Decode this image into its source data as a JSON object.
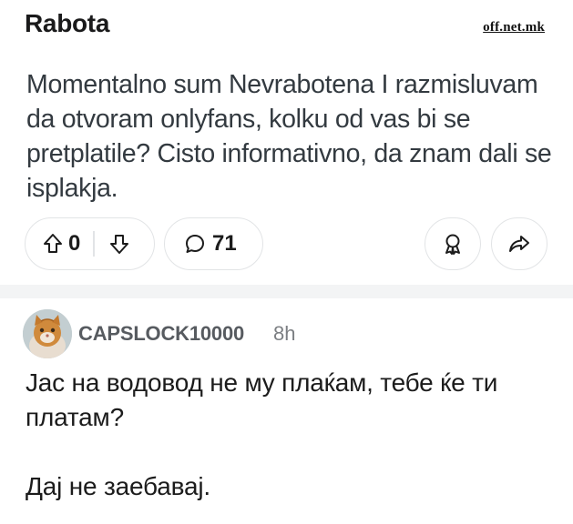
{
  "post": {
    "title": "Rabota",
    "watermark": "off.net.mk",
    "body": "Momentalno sum Nevrabotena I razmisluvam da otvoram onlyfans, kolku od vas bi se pretplatile? Cisto informativno, da znam dali se isplakja.",
    "votes": "0",
    "comments": "71",
    "icons": [
      "upvote-icon",
      "downvote-icon",
      "comment-bubble-icon",
      "award-icon",
      "share-icon"
    ]
  },
  "comment": {
    "author": "CAPSLOCK10000",
    "time": "8h",
    "body": "Јас на водовод не му плаќам, тебе ќе ти платам?\n\nДај не заебавај.",
    "avatar": "cat-avatar"
  },
  "colors": {
    "pill_border": "#e2e4e6",
    "separator": "#f3f4f5",
    "author": "#575b60",
    "body_text": "#333a40"
  }
}
